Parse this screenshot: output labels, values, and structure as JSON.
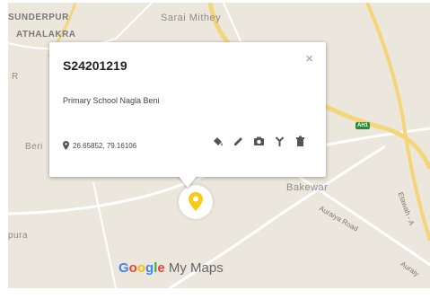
{
  "map": {
    "places": {
      "sunderpur": "SUNDERPUR",
      "athalakra": "ATHALAKRA",
      "sarai_mithey": "Sarai Mithey",
      "r_label": "R",
      "beri": "Beri",
      "bakewar": "Bakewar",
      "pura": "pura"
    },
    "roads": {
      "auraiya_road": "Auraiya Road",
      "etawah": "Etawah - A",
      "auraiya_right": "Auraiy",
      "ah1": "AH1"
    }
  },
  "infowindow": {
    "title": "S24201219",
    "description": "Primary School Nagla Beni",
    "coordinates": "26.65852, 79.16106",
    "close_symbol": "×"
  },
  "branding": {
    "google": "Google",
    "product": "My Maps"
  },
  "colors": {
    "map_background": "#ece7dc",
    "major_road": "#f5d57a",
    "marker": "#f7cb1b",
    "highway_shield": "#2e8b3d"
  }
}
